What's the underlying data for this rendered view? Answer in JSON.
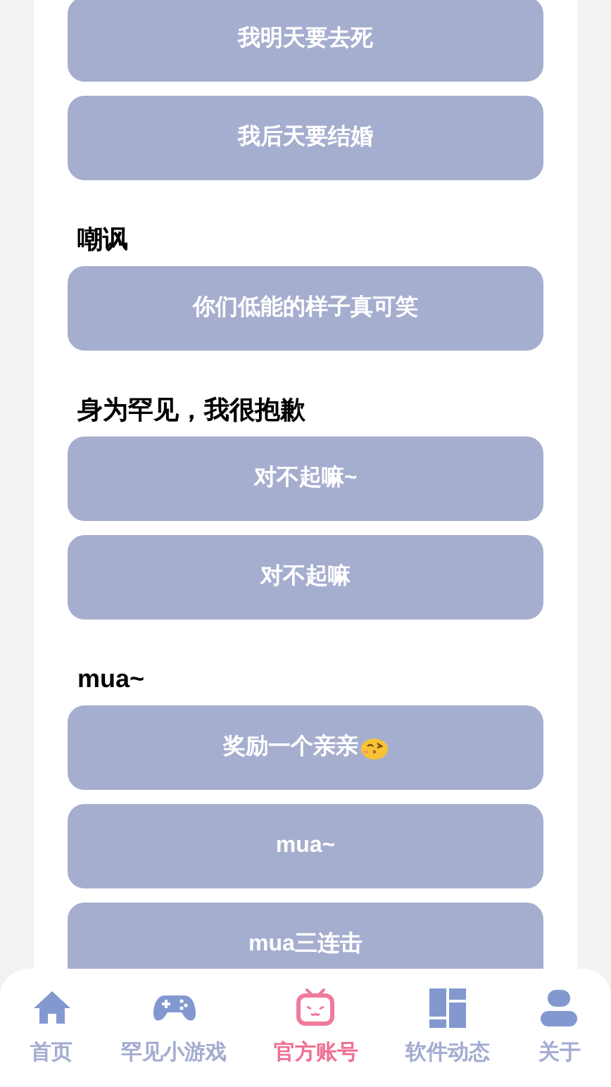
{
  "sections": [
    {
      "buttons": [
        {
          "label": "我明天要去死",
          "kind": "text"
        },
        {
          "label": "我后天要结婚",
          "kind": "text"
        }
      ]
    },
    {
      "heading": "嘲讽",
      "buttons": [
        {
          "label": "你们低能的样子真可笑",
          "kind": "text"
        }
      ]
    },
    {
      "heading": "身为罕见，我很抱歉",
      "buttons": [
        {
          "label": "对不起嘛~",
          "kind": "text"
        },
        {
          "label": "对不起嘛",
          "kind": "text"
        }
      ]
    },
    {
      "heading": "mua~",
      "buttons": [
        {
          "label": "奖励一个亲亲",
          "kind": "emoji"
        },
        {
          "label": "mua~",
          "kind": "text"
        },
        {
          "label": "mua三连击",
          "kind": "text"
        }
      ]
    }
  ],
  "nav": [
    {
      "label": "首页",
      "selected": false
    },
    {
      "label": "罕见小游戏",
      "selected": false
    },
    {
      "label": "官方账号",
      "selected": true
    },
    {
      "label": "软件动态",
      "selected": false
    },
    {
      "label": "关于",
      "selected": false
    }
  ]
}
